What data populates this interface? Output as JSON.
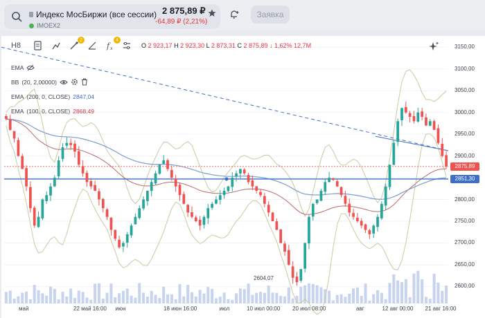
{
  "header": {
    "instrument_name": "Индекс МосБиржи (все сессии)",
    "instrument_code": "IMOEX2",
    "price": "2 875,89 ₽",
    "change": "-64,89 ₽ (2,21%)",
    "order_button": "Заявка"
  },
  "toolbar": {
    "interval": "H8",
    "badge_drawings": "2",
    "badge_indicators": "4",
    "ohlc": {
      "o_label": "O",
      "o_value": "2 923,17",
      "h_label": "H",
      "h_value": "2 923,30",
      "l_label": "L",
      "l_value": "2 873,31",
      "c_label": "C",
      "c_value": "2 875,89",
      "change": "↓ 1,62%",
      "volume": "12,7M"
    }
  },
  "legend": {
    "ema_label": "EMA",
    "bb_label": "BB",
    "bb_params": "(20, 2,00000)",
    "ema200_label": "EMA",
    "ema200_params": "(200, 0, CLOSE)",
    "ema200_value": "2847,04",
    "ema100_label": "EMA",
    "ema100_params": "(100, 0, CLOSE)",
    "ema100_value": "2868,49"
  },
  "price_labels": {
    "current": "2875,89",
    "ema": "2851,30",
    "low": "2604,07"
  },
  "colors": {
    "up": "#26a69a",
    "down": "#ef5350",
    "ema200": "#7b9bd1",
    "ema100": "#b86a6a",
    "bollinger": "#c8caa0",
    "trendline": "#3e6ec9",
    "volume": "#c8d3ee"
  },
  "chart_data": {
    "type": "candlestick",
    "y_ticks": [
      "3150,00",
      "3100,00",
      "3050,00",
      "3000,00",
      "2950,00",
      "2900,00",
      "2850,00",
      "2800,00",
      "2750,00",
      "2700,00",
      "2650,00",
      "2600,00"
    ],
    "x_ticks": [
      "май",
      "22 май 16:00",
      "июн",
      "18 июн 16:00",
      "июл",
      "10 июл 00:00",
      "20 июл 08:00",
      "авг",
      "12 авг 00:00",
      "21 авг 16:00"
    ],
    "ylim": [
      2580,
      3160
    ],
    "closes": [
      2985,
      2960,
      2940,
      2900,
      2870,
      2830,
      2780,
      2740,
      2760,
      2800,
      2810,
      2830,
      2850,
      2890,
      2920,
      2930,
      2925,
      2910,
      2880,
      2860,
      2840,
      2830,
      2820,
      2800,
      2780,
      2760,
      2730,
      2710,
      2690,
      2700,
      2720,
      2740,
      2760,
      2780,
      2800,
      2820,
      2840,
      2860,
      2880,
      2890,
      2870,
      2850,
      2830,
      2810,
      2790,
      2770,
      2760,
      2750,
      2740,
      2760,
      2780,
      2790,
      2800,
      2810,
      2820,
      2830,
      2850,
      2860,
      2870,
      2860,
      2840,
      2830,
      2820,
      2810,
      2790,
      2770,
      2750,
      2730,
      2700,
      2680,
      2650,
      2620,
      2610,
      2640,
      2700,
      2760,
      2790,
      2800,
      2820,
      2840,
      2850,
      2845,
      2830,
      2810,
      2790,
      2770,
      2760,
      2750,
      2740,
      2730,
      2720,
      2740,
      2760,
      2790,
      2830,
      2880,
      2930,
      2980,
      3010,
      3000,
      2990,
      2980,
      3000,
      2990,
      2970,
      2980,
      2960,
      2930,
      2900,
      2876
    ],
    "ema200": 2847.04,
    "ema100": 2868.49,
    "last": 2875.89,
    "low": 2604.07
  }
}
